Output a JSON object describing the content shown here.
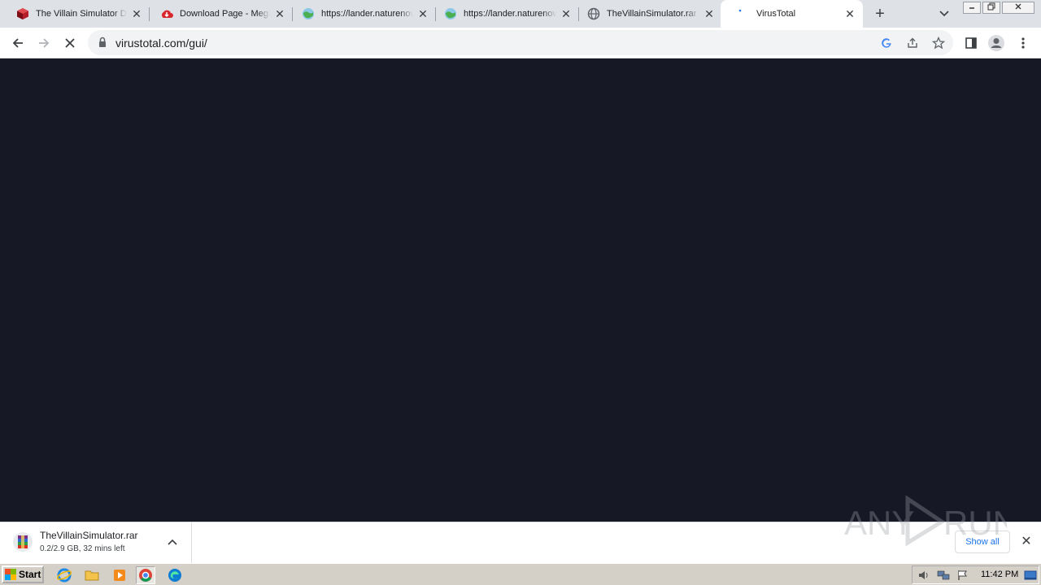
{
  "tabs": [
    {
      "title": "The Villain Simulator Download",
      "icon": "red-cube-icon",
      "active": false
    },
    {
      "title": "Download Page - Mega",
      "icon": "mega-cloud-icon",
      "active": false
    },
    {
      "title": "https://lander.naturenow",
      "icon": "globe-green-icon",
      "active": false
    },
    {
      "title": "https://lander.naturenow",
      "icon": "globe-green-icon",
      "active": false
    },
    {
      "title": "TheVillainSimulator.rar",
      "icon": "globe-icon",
      "active": false
    },
    {
      "title": "VirusTotal",
      "icon": "loading-spinner-icon",
      "active": true
    }
  ],
  "toolbar": {
    "url": "virustotal.com/gui/"
  },
  "content": {
    "background": "#171826"
  },
  "download": {
    "filename": "TheVillainSimulator.rar",
    "status": "0.2/2.9 GB, 32 mins left",
    "show_all": "Show all"
  },
  "watermark": {
    "text_left": "ANY",
    "text_right": "RUN"
  },
  "taskbar": {
    "start_label": "Start",
    "time": "11:42 PM"
  }
}
